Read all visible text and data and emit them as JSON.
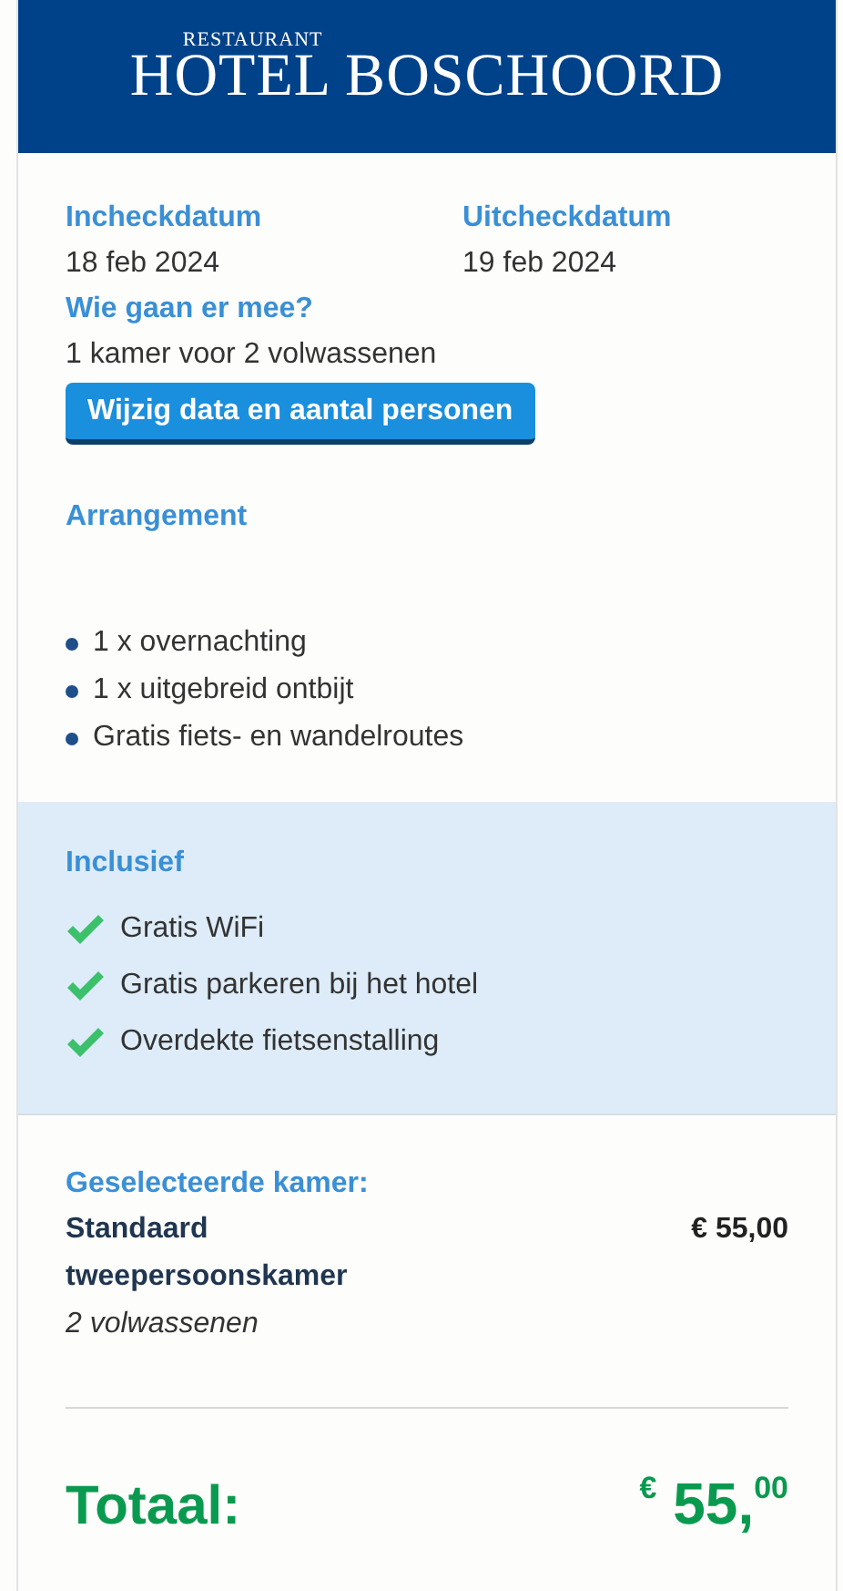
{
  "header": {
    "logo_small": "RESTAURANT",
    "logo": "HOTEL BOSCHOORD"
  },
  "booking": {
    "checkin": {
      "label": "Incheckdatum",
      "value": "18 feb 2024"
    },
    "checkout": {
      "label": "Uitcheckdatum",
      "value": "19 feb 2024"
    },
    "guests": {
      "label": "Wie gaan er mee?",
      "value": "1 kamer voor 2 volwassenen"
    },
    "change_button": "Wijzig data en aantal personen"
  },
  "arrangement": {
    "title": "Arrangement",
    "items": [
      "1 x overnachting",
      "1 x uitgebreid ontbijt",
      "Gratis fiets- en wandelroutes"
    ]
  },
  "inclusive": {
    "title": "Inclusief",
    "items": [
      "Gratis WiFi",
      "Gratis parkeren bij het hotel",
      "Overdekte fietsenstalling"
    ]
  },
  "selected_room": {
    "label": "Geselecteerde kamer:",
    "name": "Standaard tweepersoonskamer",
    "guests": "2 volwassenen",
    "price": "€ 55,00"
  },
  "total": {
    "label": "Totaal:",
    "price": "$^{€}$ 55,$^{00}$"
  }
}
